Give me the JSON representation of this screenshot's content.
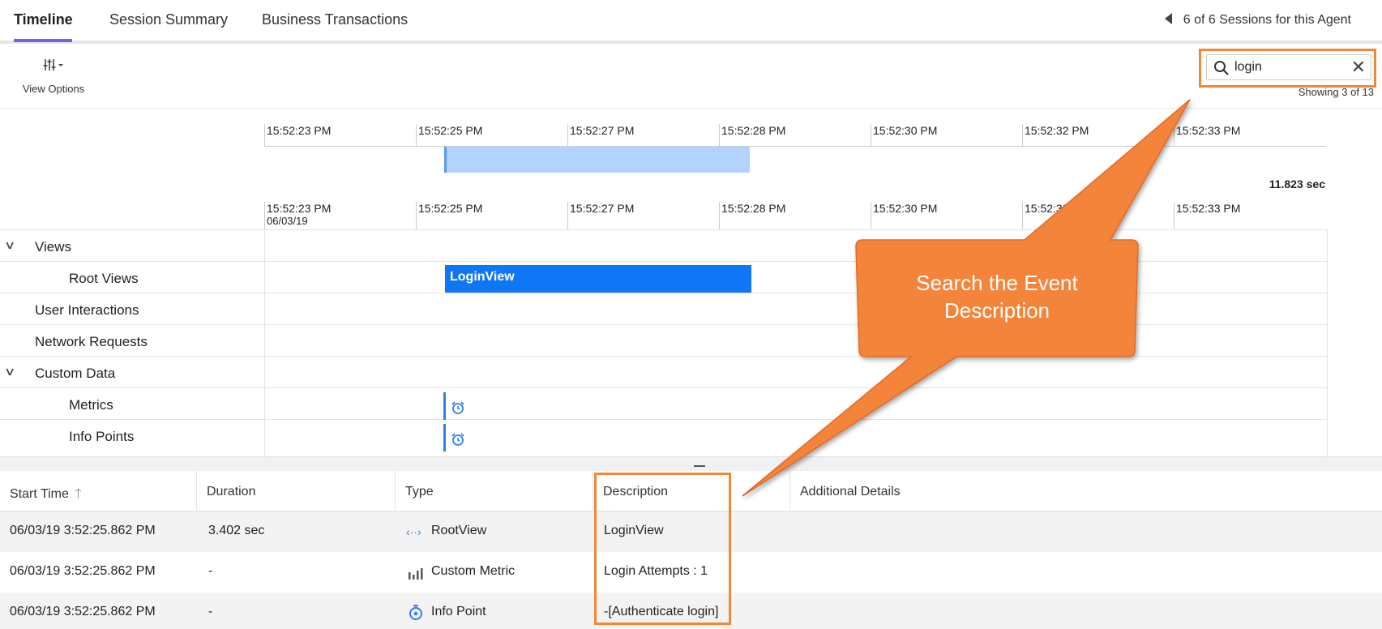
{
  "tabs": [
    {
      "label": "Timeline",
      "active": true
    },
    {
      "label": "Session Summary",
      "active": false
    },
    {
      "label": "Business Transactions",
      "active": false
    }
  ],
  "sessions_nav": "6 of 6 Sessions for this Agent",
  "view_options": {
    "label": "View Options",
    "icon": "sliders-icon"
  },
  "search": {
    "value": "login",
    "clear_icon": "close-icon",
    "search_icon": "search-icon"
  },
  "showing": "Showing 3 of 13",
  "overview_axis": [
    "15:52:23 PM",
    "15:52:25 PM",
    "15:52:27 PM",
    "15:52:28 PM",
    "15:52:30 PM",
    "15:52:32 PM",
    "15:52:33 PM"
  ],
  "total_duration": "11.823 sec",
  "detail_axis": {
    "ticks": [
      "15:52:23 PM",
      "15:52:25 PM",
      "15:52:27 PM",
      "15:52:28 PM",
      "15:52:30 PM",
      "15:52:32 PM",
      "15:52:33 PM"
    ],
    "date": "06/03/19"
  },
  "lanes": {
    "views": "Views",
    "root_views": "Root Views",
    "user_interactions": "User Interactions",
    "network_requests": "Network Requests",
    "custom_data": "Custom Data",
    "metrics": "Metrics",
    "info_points": "Info Points"
  },
  "loginview_bar": "LoginView",
  "table": {
    "headers": [
      "Start Time",
      "Duration",
      "Type",
      "Description",
      "Additional Details"
    ],
    "rows": [
      {
        "start": "06/03/19 3:52:25.862 PM",
        "duration": "3.402 sec",
        "type": "RootView",
        "type_icon": "code-arrows-icon",
        "description": "LoginView"
      },
      {
        "start": "06/03/19 3:52:25.862 PM",
        "duration": "-",
        "type": "Custom Metric",
        "type_icon": "bar-chart-icon",
        "description": "Login Attempts : 1"
      },
      {
        "start": "06/03/19 3:52:25.862 PM",
        "duration": "-",
        "type": "Info Point",
        "type_icon": "stopwatch-icon",
        "description": "-[Authenticate login]"
      }
    ]
  },
  "callout": {
    "line1": "Search the Event",
    "line2": "Description",
    "color": "#f5843a"
  },
  "colors": {
    "accent": "#7b5ddd",
    "bar": "#0f77f5",
    "highlight": "#f08838",
    "overview_selection": "#b3d3ff"
  }
}
